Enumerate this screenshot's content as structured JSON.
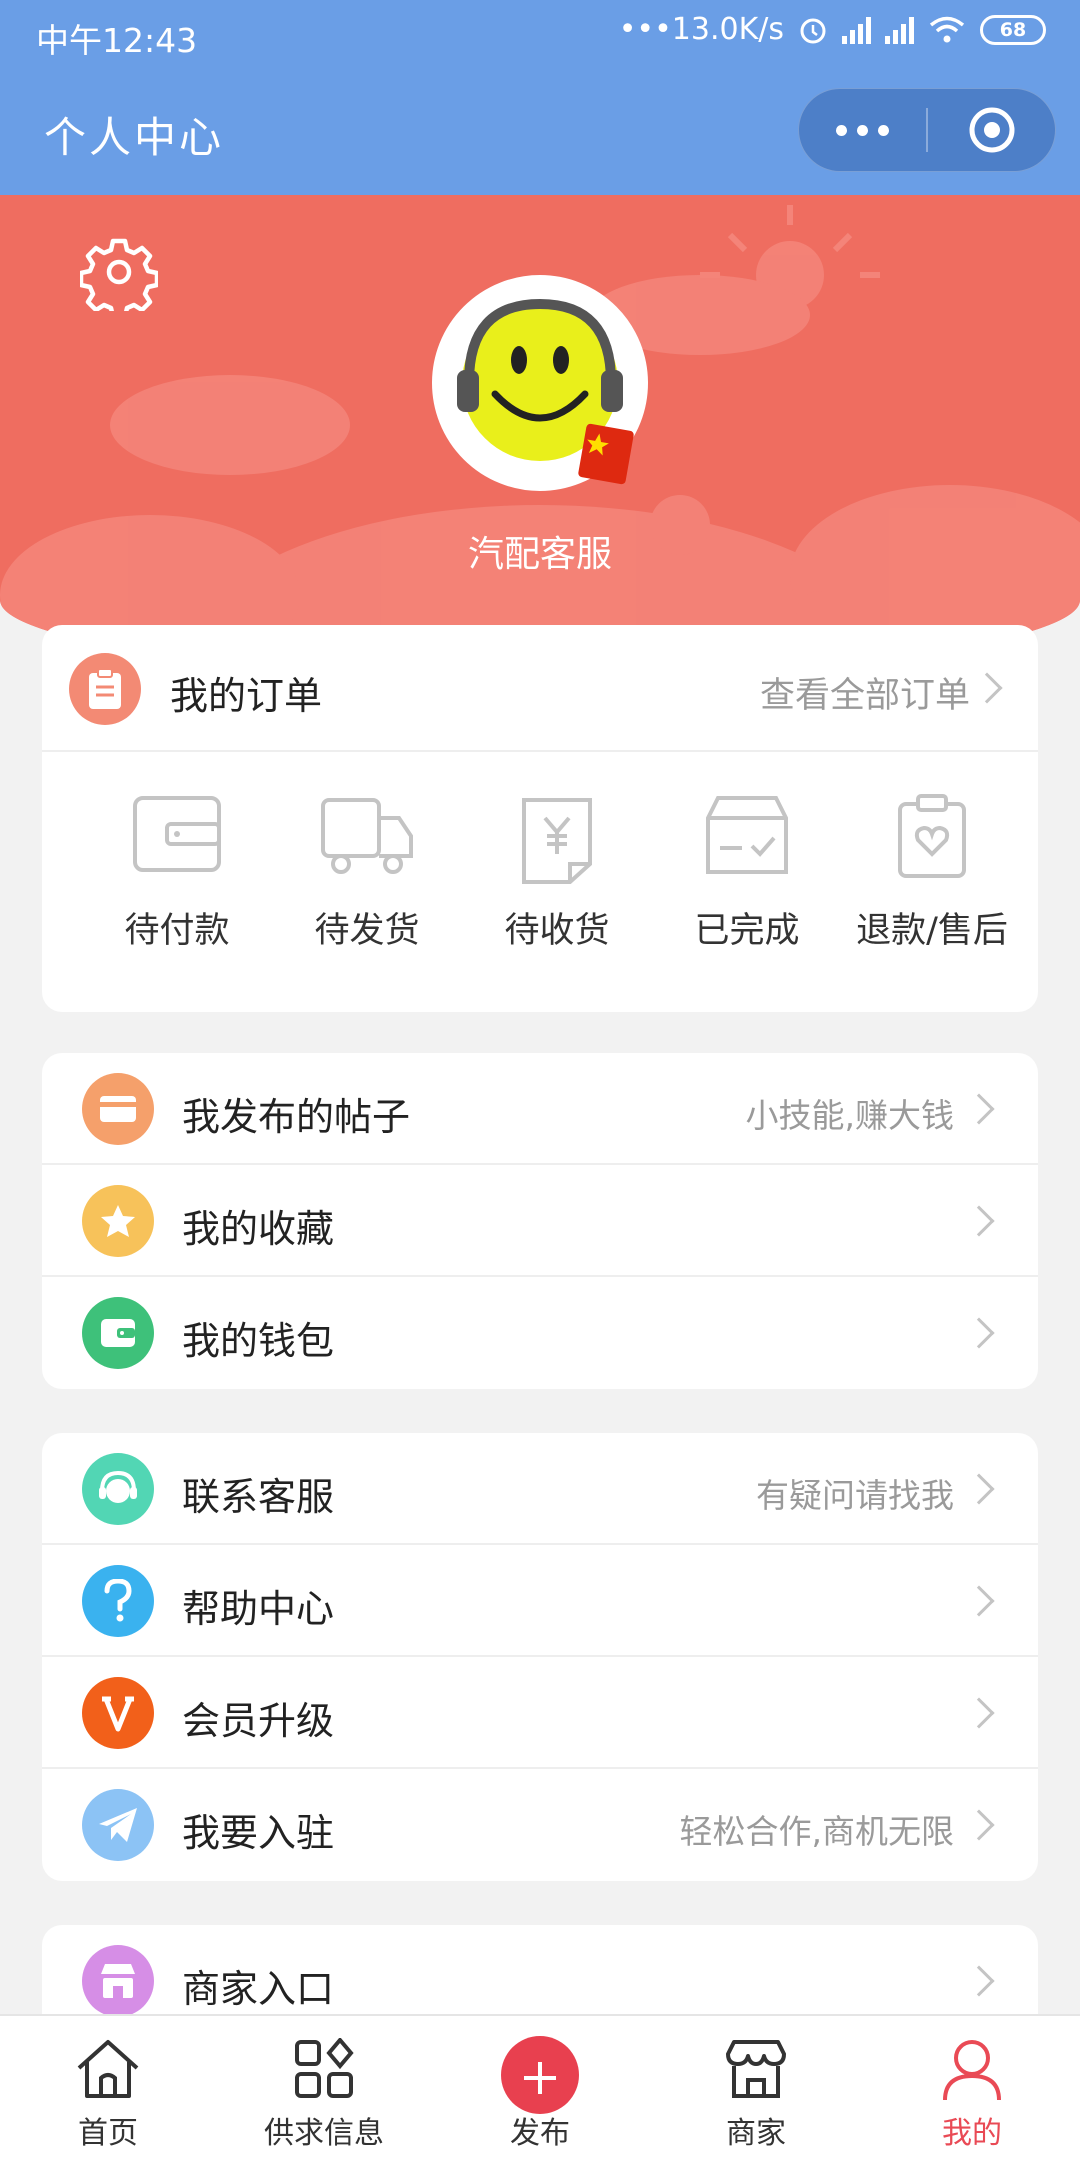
{
  "status_bar": {
    "time": "中午12:43",
    "network_speed": "•••13.0K/s",
    "battery": "68"
  },
  "header": {
    "title": "个人中心"
  },
  "profile": {
    "username": "汽配客服"
  },
  "orders": {
    "title": "我的订单",
    "view_all": "查看全部订单",
    "items": [
      {
        "label": "待付款",
        "icon": "wallet-icon"
      },
      {
        "label": "待发货",
        "icon": "truck-icon"
      },
      {
        "label": "待收货",
        "icon": "receipt-yen-icon"
      },
      {
        "label": "已完成",
        "icon": "box-check-icon"
      },
      {
        "label": "退款/售后",
        "icon": "clipboard-heart-icon"
      }
    ]
  },
  "menu_group_1": [
    {
      "label": "我发布的帖子",
      "hint": "小技能,赚大钱",
      "icon": "card-icon",
      "color": "#f5a06b"
    },
    {
      "label": "我的收藏",
      "hint": "",
      "icon": "star-icon",
      "color": "#f7c25a"
    },
    {
      "label": "我的钱包",
      "hint": "",
      "icon": "wallet-icon",
      "color": "#3ec17a"
    }
  ],
  "menu_group_2": [
    {
      "label": "联系客服",
      "hint": "有疑问请找我",
      "icon": "headset-icon",
      "color": "#52d6b4"
    },
    {
      "label": "帮助中心",
      "hint": "",
      "icon": "question-icon",
      "color": "#3ab2ef"
    },
    {
      "label": "会员升级",
      "hint": "",
      "icon": "vip-icon",
      "color": "#f2601a"
    },
    {
      "label": "我要入驻",
      "hint": "轻松合作,商机无限",
      "icon": "paper-plane-icon",
      "color": "#8cc3f5"
    }
  ],
  "menu_group_3": [
    {
      "label": "商家入口",
      "hint": "",
      "icon": "shop-icon",
      "color": "#d68ee6"
    }
  ],
  "tabbar": {
    "home": "首页",
    "supply": "供求信息",
    "publish": "发布",
    "merchant": "商家",
    "mine": "我的",
    "active_color": "#e94a55"
  }
}
